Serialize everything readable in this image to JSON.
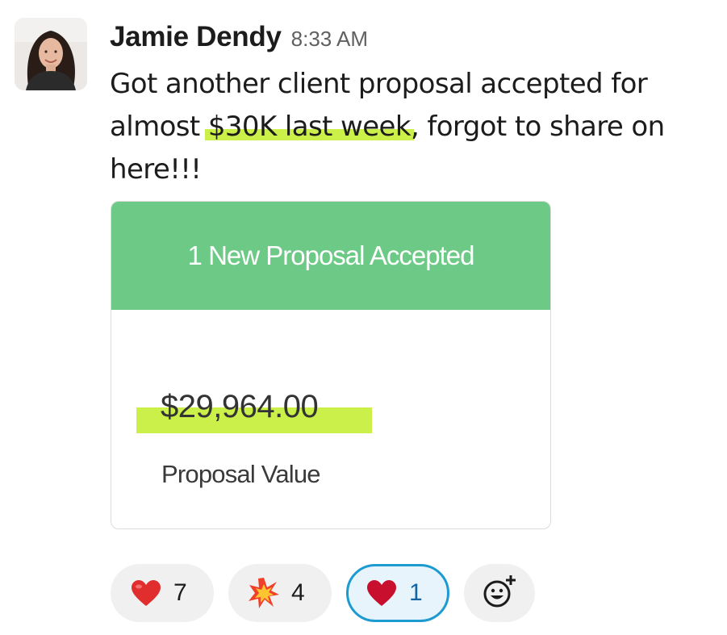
{
  "message": {
    "sender": "Jamie Dendy",
    "timestamp": "8:33 AM",
    "text_before": "Got another client proposal accepted for almost ",
    "text_highlight": "$30K last week",
    "text_after": ", forgot to share on here!!!",
    "avatar_icon": "user-avatar-photo"
  },
  "card": {
    "title": "1 New Proposal Accepted",
    "amount": "$29,964.00",
    "amount_label": "Proposal Value",
    "header_color": "#6dca86",
    "highlight_color": "#ccf04a"
  },
  "reactions": [
    {
      "emoji": "red-heart-icon",
      "count": "7",
      "selected": false
    },
    {
      "emoji": "collision-icon",
      "count": "4",
      "selected": false
    },
    {
      "emoji": "red-heart-icon",
      "count": "1",
      "selected": true
    }
  ],
  "add_reaction": {
    "icon": "add-reaction-icon"
  }
}
